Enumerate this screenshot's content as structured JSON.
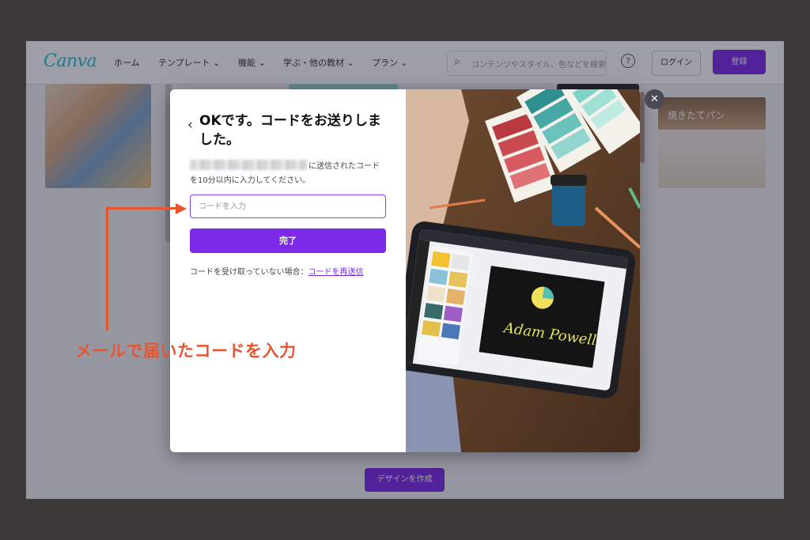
{
  "background_page": {
    "logo": "Canva",
    "nav": [
      "ホーム",
      "テンプレート ⌄",
      "機能 ⌄",
      "学ぶ・他の教材 ⌄",
      "プラン ⌄"
    ],
    "search_placeholder": "コンテンツやスタイル、色などを検索",
    "help_icon": "question-circle-icon",
    "login_label": "ログイン",
    "signup_label": "登録",
    "thumb_label": "焼きたてパン",
    "bottom_button": "デザインを作成"
  },
  "modal": {
    "back_icon": "‹",
    "title": "OKです。コードをお送りしました。",
    "desc_line1": "に送信されたコード",
    "desc_line2": "を10分以内に入力してください。",
    "code_placeholder": "コードを入力",
    "submit_label": "完了",
    "resend_prefix": "コードを受け取っていない場合：",
    "resend_link": "コードを再送信",
    "close_icon": "✕",
    "image": {
      "signature": "Adam Powell"
    }
  },
  "annotation": {
    "text": "メールで届いたコードを入力",
    "color": "#e8552e"
  },
  "colors": {
    "accent": "#7d2ae8",
    "annotation": "#e8552e"
  }
}
